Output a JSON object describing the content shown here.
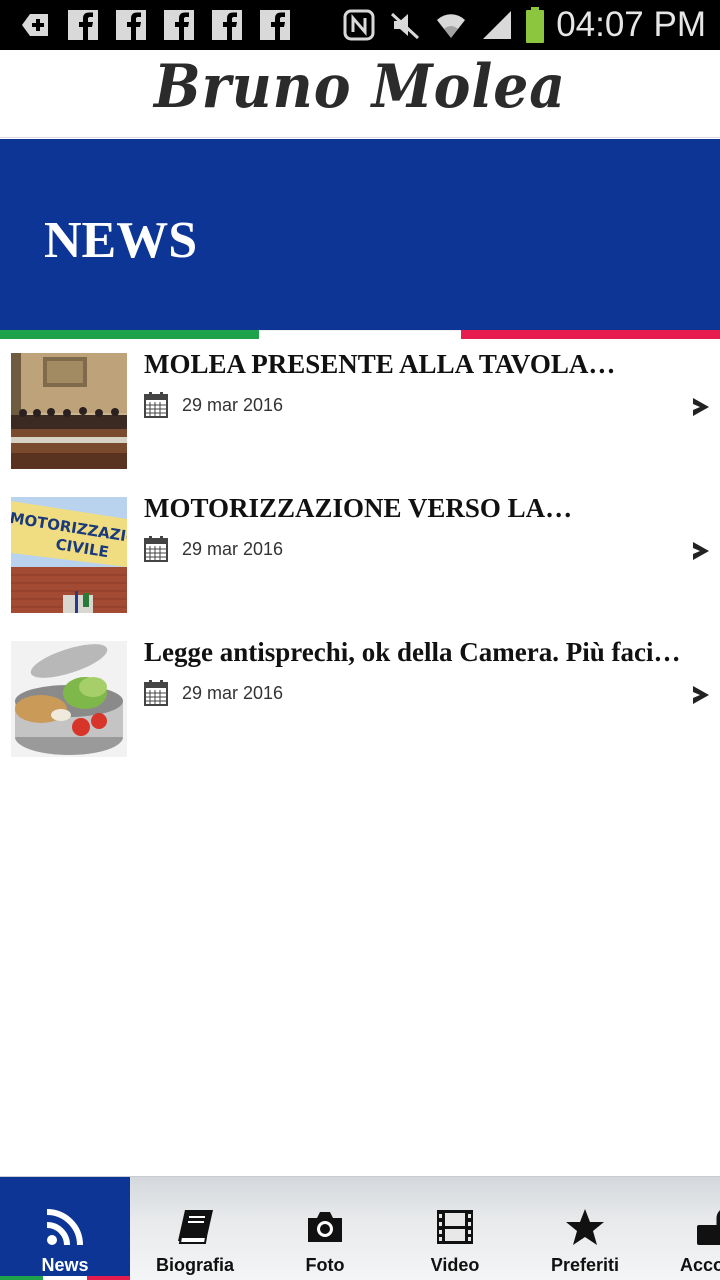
{
  "status_bar": {
    "time": "04:07 PM",
    "left_icons": [
      "plus-icon",
      "facebook-icon",
      "facebook-icon",
      "facebook-icon",
      "facebook-icon",
      "facebook-icon"
    ],
    "right_icons": [
      "nfc-icon",
      "mute-icon",
      "wifi-icon",
      "signal-icon",
      "battery-icon"
    ],
    "battery_color": "#8cc63f"
  },
  "header": {
    "logo_text": "Bruno Molea"
  },
  "banner": {
    "title": "NEWS",
    "color": "#0d3595",
    "flag_colors": [
      "#1fa34a",
      "#ffffff",
      "#e51c4d"
    ]
  },
  "news": [
    {
      "title": "MOLEA PRESENTE ALLA TAVOLA…",
      "date": "29 mar 2016"
    },
    {
      "title": "MOTORIZZAZIONE VERSO LA…",
      "date": "29 mar 2016",
      "thumb_text": [
        "MOTORIZZAZIO",
        "CIVILE"
      ]
    },
    {
      "title": "Legge antisprechi, ok della Camera. Più faci…",
      "date": "29 mar 2016"
    }
  ],
  "tabs": [
    {
      "label": "News",
      "icon": "rss-icon",
      "active": true
    },
    {
      "label": "Biografia",
      "icon": "book-icon",
      "active": false
    },
    {
      "label": "Foto",
      "icon": "camera-icon",
      "active": false
    },
    {
      "label": "Video",
      "icon": "film-icon",
      "active": false
    },
    {
      "label": "Preferiti",
      "icon": "star-icon",
      "active": false
    },
    {
      "label": "Acco",
      "icon": "lock-icon",
      "active": false
    }
  ]
}
